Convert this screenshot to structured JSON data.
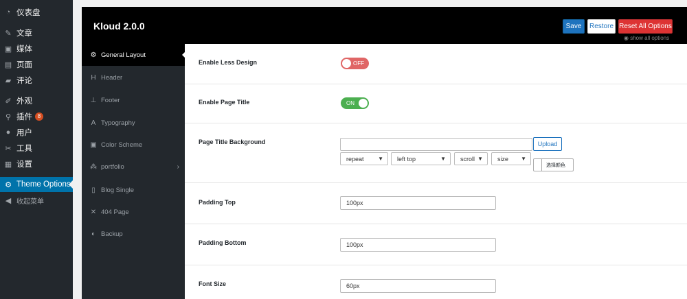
{
  "wp_menu": {
    "items": [
      {
        "label": "仪表盘",
        "icon": "dashboard-icon",
        "glyph": "◔"
      },
      {
        "label": "文章",
        "icon": "pin-icon",
        "glyph": "✎"
      },
      {
        "label": "媒体",
        "icon": "media-icon",
        "glyph": "▣"
      },
      {
        "label": "页面",
        "icon": "page-icon",
        "glyph": "▤"
      },
      {
        "label": "评论",
        "icon": "comment-icon",
        "glyph": "▰"
      },
      {
        "label": "外观",
        "icon": "brush-icon",
        "glyph": "✐"
      },
      {
        "label": "插件",
        "icon": "plugin-icon",
        "glyph": "⚲",
        "badge": "8"
      },
      {
        "label": "用户",
        "icon": "user-icon",
        "glyph": "●"
      },
      {
        "label": "工具",
        "icon": "wrench-icon",
        "glyph": "✂"
      },
      {
        "label": "设置",
        "icon": "settings-icon",
        "glyph": "▦"
      },
      {
        "label": "Theme Options",
        "icon": "gear-icon",
        "glyph": "⚙",
        "active": true
      },
      {
        "label": "收起菜单",
        "icon": "collapse-icon",
        "glyph": "◀"
      }
    ]
  },
  "panel": {
    "title": "Kloud 2.0.0",
    "buttons": {
      "save": "Save",
      "restore": "Restore",
      "reset": "Reset All Options"
    },
    "show_all": "show all options"
  },
  "sections": [
    {
      "label": "General Layout",
      "glyph": "⚙",
      "icon": "gear-icon",
      "active": true
    },
    {
      "label": "Header",
      "glyph": "H",
      "icon": "header-icon"
    },
    {
      "label": "Footer",
      "glyph": "⊥",
      "icon": "sitemap-icon"
    },
    {
      "label": "Typography",
      "glyph": "A",
      "icon": "font-icon"
    },
    {
      "label": "Color Scheme",
      "glyph": "▣",
      "icon": "image-icon"
    },
    {
      "label": "portfolio",
      "glyph": "⁂",
      "icon": "users-icon",
      "has_sub": true
    },
    {
      "label": "Blog Single",
      "glyph": "▯",
      "icon": "file-icon"
    },
    {
      "label": "404 Page",
      "glyph": "✕",
      "icon": "times-icon"
    },
    {
      "label": "Backup",
      "glyph": "◐",
      "icon": "shield-icon"
    }
  ],
  "settings": {
    "enable_less": {
      "label": "Enable Less Design",
      "state": "OFF"
    },
    "enable_title": {
      "label": "Enable Page Title",
      "state": "ON"
    },
    "title_bg": {
      "label": "Page Title Background",
      "upload_label": "Upload",
      "repeat": "repeat",
      "position": "left top",
      "attachment": "scroll",
      "size": "size",
      "color_button": "选择颜色"
    },
    "padding_top": {
      "label": "Padding Top",
      "value": "100px"
    },
    "padding_bottom": {
      "label": "Padding Bottom",
      "value": "100px"
    },
    "font_size": {
      "label": "Font Size",
      "value": "60px"
    }
  },
  "colors": {
    "accent": "#0073aa",
    "off": "#e06666",
    "on": "#4caf50",
    "reset": "#dd3333"
  }
}
